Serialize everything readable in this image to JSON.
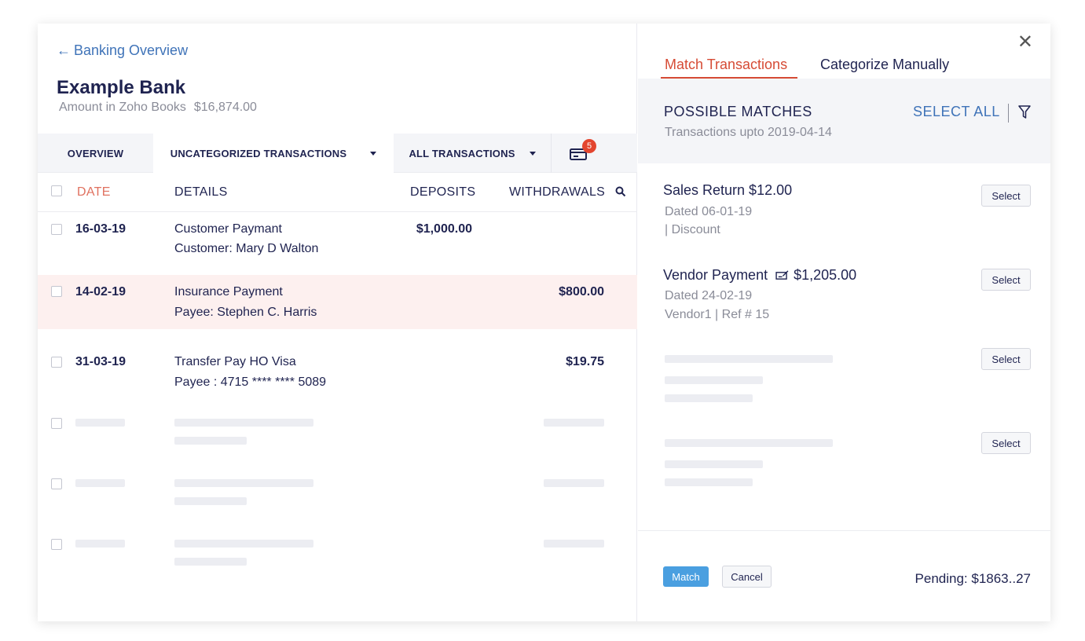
{
  "header": {
    "back_label": "Banking Overview",
    "bank_name": "Example Bank",
    "amount_label": "Amount in Zoho Books",
    "amount_value": "$16,874.00"
  },
  "tabs": {
    "overview": "OVERVIEW",
    "uncategorized": "UNCATEGORIZED TRANSACTIONS",
    "all": "ALL TRANSACTIONS",
    "feed_badge": "5"
  },
  "table": {
    "columns": {
      "date": "DATE",
      "details": "DETAILS",
      "deposits": "DEPOSITS",
      "withdrawals": "WITHDRAWALS"
    },
    "rows": [
      {
        "date": "16-03-19",
        "details_line1": "Customer Paymant",
        "details_line2": "Customer: Mary D Walton",
        "deposit": "$1,000.00",
        "withdrawal": ""
      },
      {
        "date": "14-02-19",
        "details_line1": "Insurance Payment",
        "details_line2": "Payee: Stephen C. Harris",
        "deposit": "",
        "withdrawal": "$800.00"
      },
      {
        "date": "31-03-19",
        "details_line1": "Transfer Pay HO Visa",
        "details_line2": "Payee : 4715 **** **** 5089",
        "deposit": "",
        "withdrawal": "$19.75"
      }
    ]
  },
  "panel": {
    "tab_match": "Match Transactions",
    "tab_categorize": "Categorize Manually",
    "title": "POSSIBLE MATCHES",
    "subtitle": "Transactions upto 2019-04-14",
    "select_all": "SELECT ALL",
    "matches": [
      {
        "title": "Sales Return $12.00",
        "line1": "Dated 06-01-19",
        "line2": "| Discount",
        "select": "Select"
      },
      {
        "title": "Vendor Payment",
        "amount": "$1,205.00",
        "line1": "Dated 24-02-19",
        "line2": "Vendor1 | Ref # 15",
        "select": "Select"
      }
    ],
    "placeholder_select": "Select",
    "match_btn": "Match",
    "cancel_btn": "Cancel",
    "pending": "Pending: $1863..27"
  },
  "colors": {
    "accent_red": "#d64b35",
    "link_blue": "#3f73b8",
    "match_blue": "#4a9fe0",
    "badge_red": "#e3452f"
  }
}
